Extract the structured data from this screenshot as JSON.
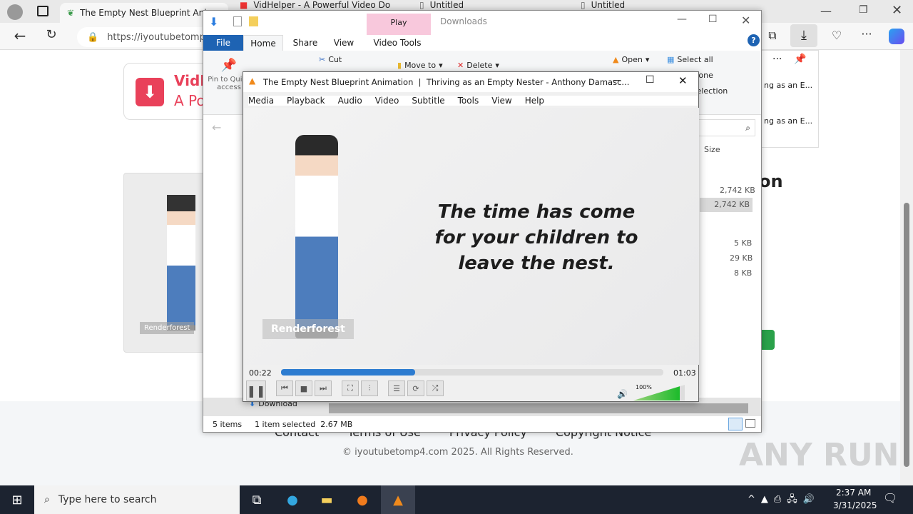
{
  "browser": {
    "tabs": [
      {
        "title": "The Empty Nest Blueprint Anim"
      },
      {
        "title": "VidHelper - A Powerful Video Do"
      },
      {
        "title": "Untitled"
      },
      {
        "title": "Untitled"
      }
    ],
    "url": "https://iyoutubetomp4",
    "download_panel": {
      "items": [
        "ng as an E...",
        "ng as an E..."
      ]
    }
  },
  "webpage": {
    "brand_name": "VidH",
    "brand_tagline": "A Po",
    "heading_fragment": "on",
    "footer_links": [
      "Contact",
      "Terms of Use",
      "Privacy Policy",
      "Copyright Notice"
    ],
    "copyright": "© iyoutubetomp4.com 2025. All Rights Reserved.",
    "watermark_small": "Renderforest"
  },
  "explorer": {
    "title": "Downloads",
    "context_tab": "Play",
    "ribbon_tabs": [
      "File",
      "Home",
      "Share",
      "View",
      "Video Tools"
    ],
    "ribbon": {
      "pin": "Pin to Quick access",
      "cut": "Cut",
      "move_to": "Move to",
      "delete": "Delete",
      "open": "Open",
      "select_all": "Select all",
      "select_none": "Select none",
      "invert_selection": "Invert selection",
      "select_frag": "lect"
    },
    "column_size": "Size",
    "sizes": [
      "2,742 KB",
      "2,742 KB",
      "5 KB",
      "29 KB",
      "8 KB"
    ],
    "nav_item": "Download",
    "status": {
      "items": "5 items",
      "selected": "1 item selected  2.67 MB"
    }
  },
  "vlc": {
    "title": "The Empty Nest Blueprint Animation  |  Thriving as an Empty Nester - Anthony Damasc...",
    "menu": [
      "Media",
      "Playback",
      "Audio",
      "Video",
      "Subtitle",
      "Tools",
      "View",
      "Help"
    ],
    "caption": [
      "The time has come",
      "for your children to",
      "leave the nest."
    ],
    "watermark": "Renderforest",
    "time_elapsed": "00:22",
    "time_total": "01:03",
    "progress": 0.35,
    "volume": "100%",
    "volume_level": 1.0
  },
  "taskbar": {
    "search_placeholder": "Type here to search",
    "time": "2:37 AM",
    "date": "3/31/2025"
  },
  "anyrun": "ANY RUN"
}
